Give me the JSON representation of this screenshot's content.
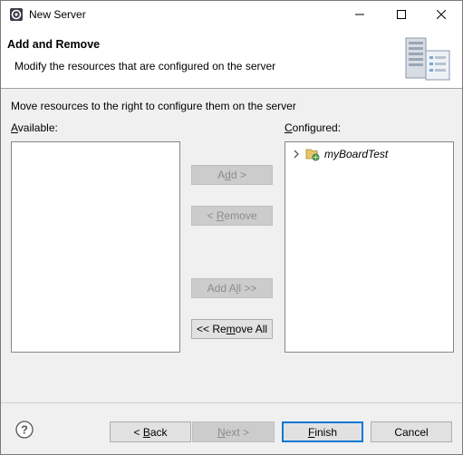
{
  "window": {
    "title": "New Server",
    "icon": "eclipse-server-icon"
  },
  "banner": {
    "title": "Add and Remove",
    "description": "Modify the resources that are configured on the server",
    "image": "server-wizard-banner-icon"
  },
  "body": {
    "instruction": "Move resources to the right to configure them on the server",
    "available_label": {
      "mnemonic": "A",
      "rest": "vailable:"
    },
    "configured_label": {
      "mnemonic": "C",
      "rest": "onfigured:"
    },
    "available_items": [],
    "configured_items": [
      {
        "name": "myBoardTest",
        "icon": "web-project-icon",
        "expandable": true
      }
    ]
  },
  "transfer_buttons": {
    "add": {
      "pre": "A",
      "mnemonic": "d",
      "post": "d >",
      "enabled": false
    },
    "remove": {
      "pre": "< ",
      "mnemonic": "R",
      "post": "emove",
      "enabled": false
    },
    "add_all": {
      "pre": "Add A",
      "mnemonic": "l",
      "post": "l >>",
      "enabled": false
    },
    "remove_all": {
      "pre": "<< Re",
      "mnemonic": "m",
      "post": "ove All",
      "enabled": true
    }
  },
  "footer": {
    "help_icon": "help-icon",
    "back": {
      "pre": "< ",
      "mnemonic": "B",
      "post": "ack",
      "enabled": true
    },
    "next": {
      "pre": "",
      "mnemonic": "N",
      "post": "ext >",
      "enabled": false
    },
    "finish": {
      "pre": "",
      "mnemonic": "F",
      "post": "inish",
      "enabled": true,
      "default": true
    },
    "cancel": {
      "label": "Cancel",
      "enabled": true
    }
  }
}
